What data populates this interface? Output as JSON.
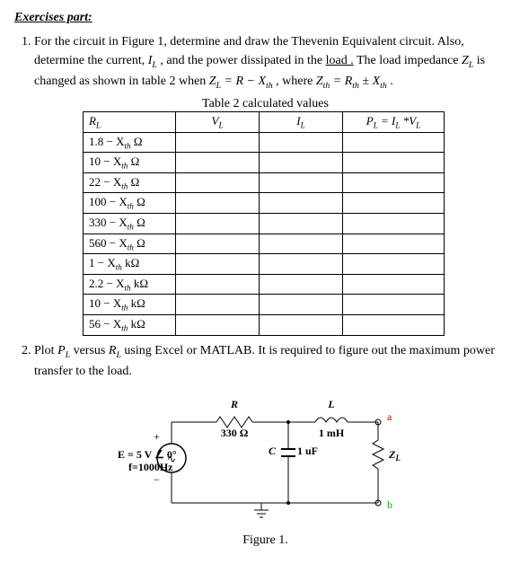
{
  "header": "Exercises part:",
  "q1": {
    "text_a": "For the circuit in Figure 1, determine and draw the Thevenin Equivalent circuit. Also, determine the current, ",
    "IL": "I",
    "ILsub": "L",
    "text_b": " , and the power dissipated in the ",
    "load": "load .",
    "text_c": " The load impedance ",
    "ZL": "Z",
    "ZLsub": "L",
    "text_d": " is changed as shown in table 2 when ",
    "eq1_lhs": "Z",
    "eq1_lhs_sub": "L",
    "eq1_mid": " = R − X",
    "eq1_mid_sub": "th",
    "eq1_tail": " , where ",
    "eq2_lhs": "Z",
    "eq2_lhs_sub": "th",
    "eq2_mid": " = R",
    "eq2_mid_sub": "th",
    "eq2_pm": " ± X",
    "eq2_pm_sub": "th",
    "eq2_end": " ."
  },
  "table": {
    "caption": "Table 2 calculated values",
    "head": {
      "c1": "R",
      "c1sub": "L",
      "c2": "V",
      "c2sub": "L",
      "c3": "I",
      "c3sub": "L",
      "c4_a": "P",
      "c4_asub": "L",
      "c4_eq": " = I",
      "c4_eqsub": "L",
      "c4_mul": " *V",
      "c4_mulsub": "L"
    },
    "rows": [
      {
        "c1_a": "1.8 − X",
        "c1_sub": "th",
        "c1_u": " Ω"
      },
      {
        "c1_a": "10 − X",
        "c1_sub": "th",
        "c1_u": " Ω"
      },
      {
        "c1_a": "22 − X",
        "c1_sub": "th",
        "c1_u": " Ω"
      },
      {
        "c1_a": "100 − X",
        "c1_sub": "th",
        "c1_u": " Ω"
      },
      {
        "c1_a": "330 − X",
        "c1_sub": "th",
        "c1_u": " Ω"
      },
      {
        "c1_a": "560 − X",
        "c1_sub": "th",
        "c1_u": " Ω"
      },
      {
        "c1_a": "1 − X",
        "c1_sub": "th",
        "c1_u": " kΩ"
      },
      {
        "c1_a": "2.2 − X",
        "c1_sub": "th",
        "c1_u": " kΩ"
      },
      {
        "c1_a": "10 − X",
        "c1_sub": "th",
        "c1_u": " kΩ"
      },
      {
        "c1_a": "56 − X",
        "c1_sub": "th",
        "c1_u": " kΩ"
      }
    ]
  },
  "q2": {
    "text_a": "Plot ",
    "PL": "P",
    "PLsub": "L",
    "text_b": " versus ",
    "RL": "R",
    "RLsub": "L",
    "text_c": " using Excel or MATLAB. It is required to figure out the maximum power transfer to the load."
  },
  "circuit": {
    "R_label": "R",
    "R_val": "330 Ω",
    "L_label": "L",
    "L_val": "1 mH",
    "C_label": "C",
    "C_val": "1 uF",
    "E_line1": "E  =  5 V ∠ 0°",
    "E_line2": "f=1000Hz",
    "node_a": "a",
    "node_b": "b",
    "ZL": "Z",
    "ZLsub": "L",
    "plus": "+",
    "minus": "−",
    "coil": "∿"
  },
  "figcap": "Figure 1."
}
